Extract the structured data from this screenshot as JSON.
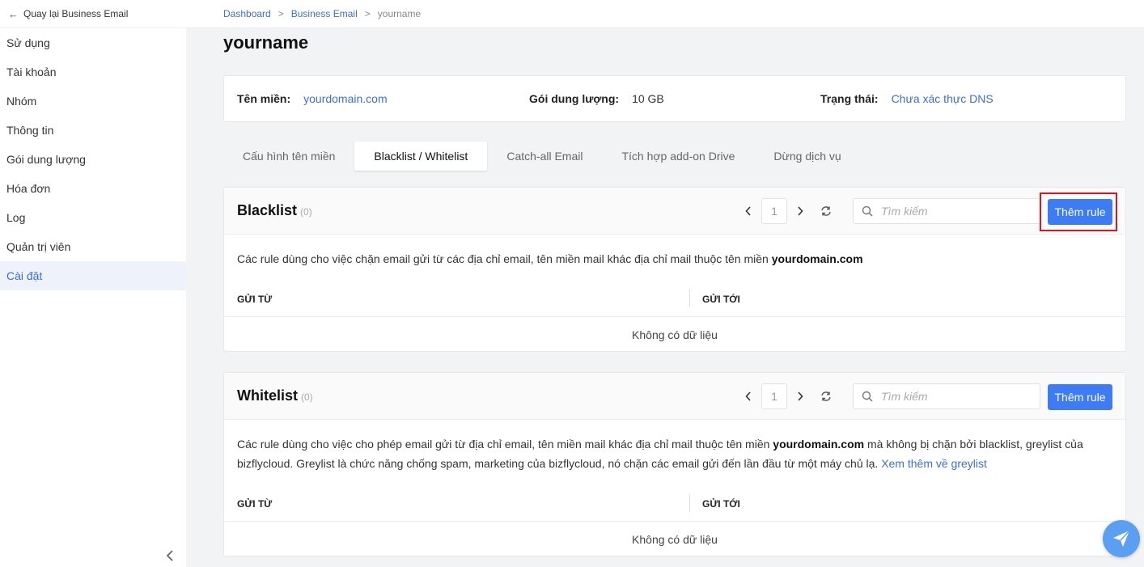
{
  "sidebar": {
    "back_label": "Quay lại Business Email",
    "items": [
      {
        "label": "Sử dụng"
      },
      {
        "label": "Tài khoản"
      },
      {
        "label": "Nhóm"
      },
      {
        "label": "Thông tin"
      },
      {
        "label": "Gói dung lượng"
      },
      {
        "label": "Hóa đơn"
      },
      {
        "label": "Log"
      },
      {
        "label": "Quản trị viên"
      },
      {
        "label": "Cài đặt",
        "active": true
      }
    ]
  },
  "breadcrumb": {
    "items": [
      "Dashboard",
      "Business Email"
    ],
    "current": "yourname",
    "separator": ">"
  },
  "page": {
    "title": "yourname"
  },
  "info": {
    "domain_label": "Tên miền:",
    "domain_value": "yourdomain.com",
    "plan_label": "Gói dung lượng:",
    "plan_value": "10 GB",
    "status_label": "Trạng thái:",
    "status_value": "Chưa xác thực DNS"
  },
  "tabs": [
    {
      "label": "Cấu hình tên miền"
    },
    {
      "label": "Blacklist / Whitelist",
      "active": true
    },
    {
      "label": "Catch-all Email"
    },
    {
      "label": "Tích hợp add-on Drive"
    },
    {
      "label": "Dừng dịch vụ"
    }
  ],
  "blacklist": {
    "title": "Blacklist",
    "count": "(0)",
    "page": "1",
    "search_placeholder": "Tìm kiếm",
    "add_label": "Thêm rule",
    "desc_prefix": "Các rule dùng cho việc chặn email gửi từ các địa chỉ email, tên miền mail khác địa chỉ mail thuộc tên miền ",
    "desc_domain": "yourdomain.com",
    "col_from": "GỬI TỪ",
    "col_to": "GỬI TỚI",
    "empty": "Không có dữ liệu"
  },
  "whitelist": {
    "title": "Whitelist",
    "count": "(0)",
    "page": "1",
    "search_placeholder": "Tìm kiếm",
    "add_label": "Thêm rule",
    "desc_prefix": "Các rule dùng cho việc cho phép email gửi từ địa chỉ email, tên miền mail khác địa chỉ mail thuộc tên miền ",
    "desc_domain": "yourdomain.com",
    "desc_suffix": " mà không bị chặn bởi blacklist, greylist của bizflycloud. Greylist là chức năng chống spam, marketing của bizflycloud, nó chặn các email gửi đến lần đầu từ một máy chủ lạ. ",
    "desc_link": "Xem thêm về greylist",
    "col_from": "GỬI TỪ",
    "col_to": "GỬI TỚI",
    "empty": "Không có dữ liệu"
  },
  "icons": {
    "back": "arrow-left-icon",
    "prev": "chevron-left-icon",
    "next": "chevron-right-icon",
    "refresh": "refresh-icon",
    "search": "search-icon",
    "collapse": "chevron-left-icon",
    "chat": "paper-plane-icon"
  },
  "colors": {
    "accent": "#3d7cf5",
    "link": "#3b6fd6",
    "highlight": "#e0141e"
  }
}
